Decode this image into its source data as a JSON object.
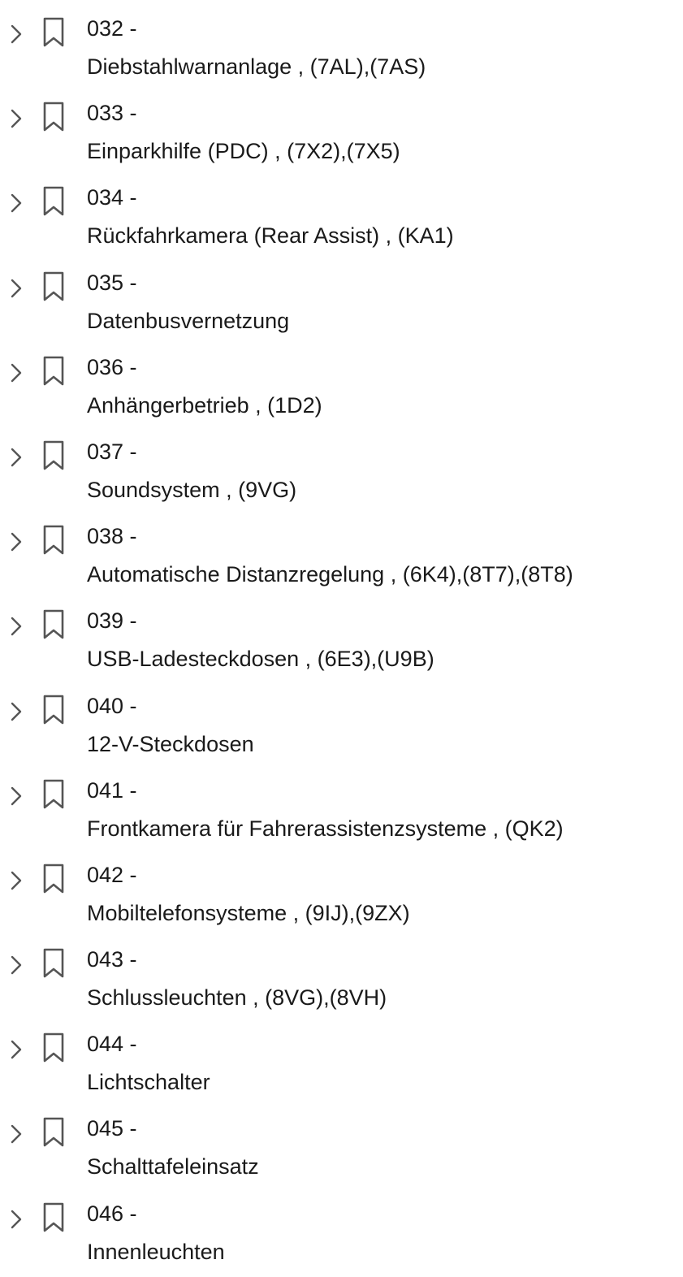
{
  "bookmarks": [
    {
      "number": "032 -",
      "title": "Diebstahlwarnanlage , (7AL),(7AS)"
    },
    {
      "number": "033 -",
      "title": "Einparkhilfe (PDC) , (7X2),(7X5)"
    },
    {
      "number": "034 -",
      "title": "Rückfahrkamera (Rear Assist) , (KA1)"
    },
    {
      "number": "035 -",
      "title": "Datenbusvernetzung"
    },
    {
      "number": "036 -",
      "title": "Anhängerbetrieb , (1D2)"
    },
    {
      "number": "037 -",
      "title": "Soundsystem , (9VG)"
    },
    {
      "number": "038 -",
      "title": "Automatische Distanzregelung , (6K4),(8T7),(8T8)"
    },
    {
      "number": "039 -",
      "title": "USB-Ladesteckdosen , (6E3),(U9B)"
    },
    {
      "number": "040 -",
      "title": "12-V-Steckdosen"
    },
    {
      "number": "041 -",
      "title": "Frontkamera für Fahrerassistenzsysteme , (QK2)"
    },
    {
      "number": "042 -",
      "title": "Mobiltelefonsysteme , (9IJ),(9ZX)"
    },
    {
      "number": "043 -",
      "title": "Schlussleuchten , (8VG),(8VH)"
    },
    {
      "number": "044 -",
      "title": "Lichtschalter"
    },
    {
      "number": "045 -",
      "title": "Schalttafeleinsatz"
    },
    {
      "number": "046 -",
      "title": "Innenleuchten"
    }
  ],
  "icons": {
    "expand": "chevron-right-icon",
    "bookmark": "bookmark-icon"
  },
  "colors": {
    "text": "#1a1a1a",
    "icon": "#555555",
    "background": "#ffffff"
  }
}
